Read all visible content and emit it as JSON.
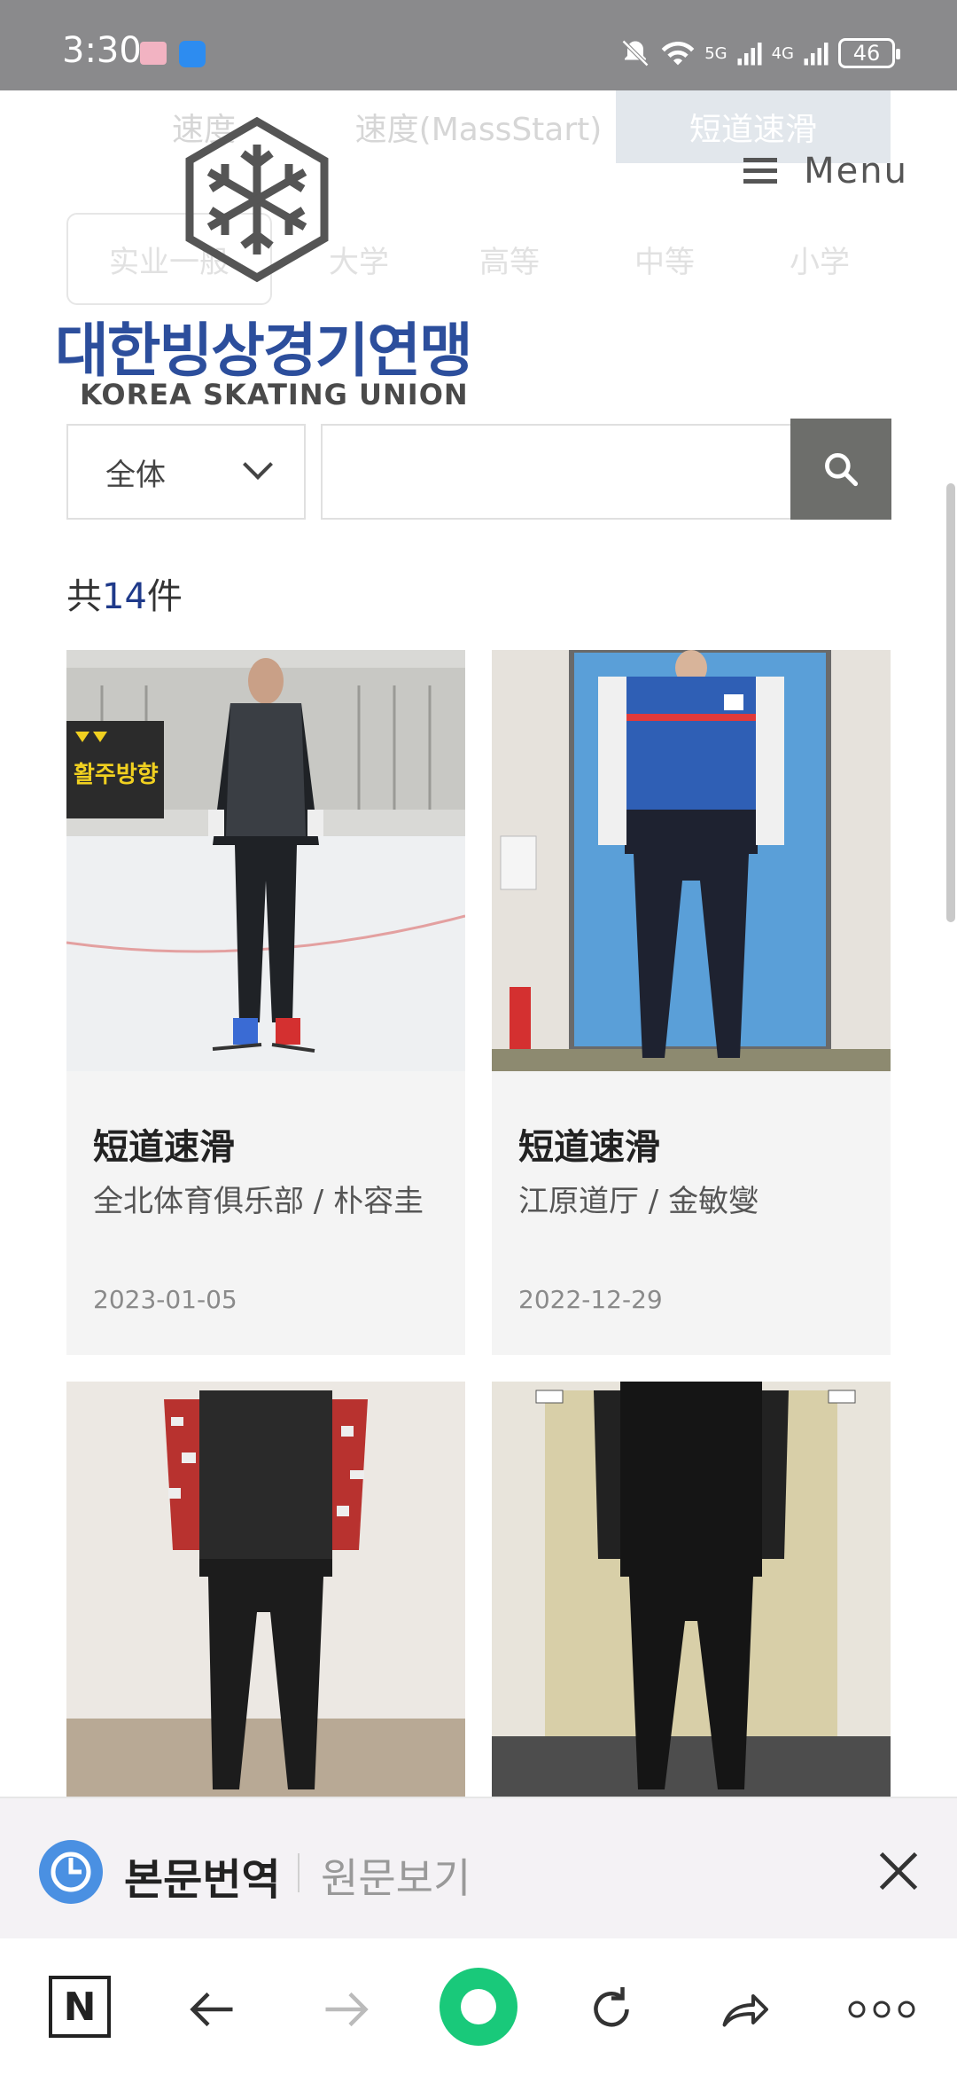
{
  "status": {
    "time": "3:30",
    "network1": "5G",
    "network2": "4G",
    "battery": "46"
  },
  "category_tabs": [
    "速度",
    "速度(MassStart)",
    "短道速滑"
  ],
  "sub_tabs": [
    "实业一般",
    "大学",
    "高等",
    "中等",
    "小学"
  ],
  "logo": {
    "korean": "대한빙상경기연맹",
    "english": "KOREA SKATING UNION"
  },
  "menu": {
    "label": "Menu"
  },
  "search": {
    "select_value": "全体",
    "placeholder": ""
  },
  "count": {
    "prefix": "共",
    "number": "14",
    "suffix": "件"
  },
  "cards": [
    {
      "title": "短道速滑",
      "subtitle": "全北体育俱乐部 / 朴容圭",
      "date": "2023-01-05",
      "photo_sign": "활주방향"
    },
    {
      "title": "短道速滑",
      "subtitle": "江原道厅 / 金敏燮",
      "date": "2022-12-29"
    },
    {
      "title": "",
      "subtitle": "",
      "date": ""
    },
    {
      "title": "",
      "subtitle": "",
      "date": ""
    }
  ],
  "translate_bar": {
    "main": "본문번역",
    "original": "원문보기"
  },
  "bottom_nav": {
    "n_label": "N"
  },
  "colors": {
    "status_bar": "#8a8a8c",
    "logo_blue": "#2c4e9c",
    "search_button": "#6d6e6b",
    "count_accent": "#1f3a8a",
    "nav_green": "#19c97a"
  }
}
